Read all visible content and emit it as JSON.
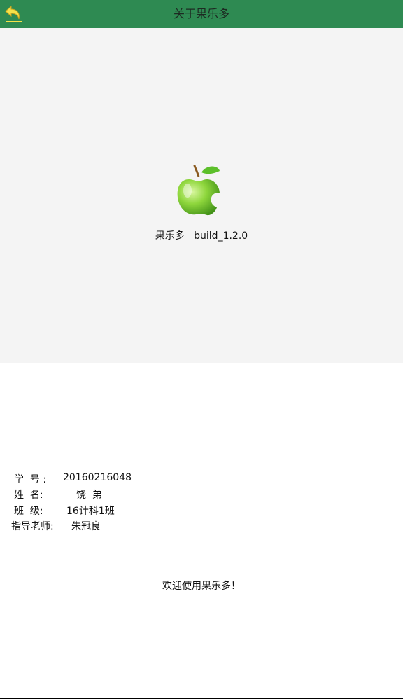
{
  "toolbar": {
    "title": "关于果乐多",
    "back_icon": "back-arrow-icon",
    "color": "#2e8a52"
  },
  "about": {
    "logo_icon": "green-apple-icon",
    "version_line": "果乐多   build_1.2.0",
    "background": "#f4f4f4"
  },
  "info": [
    {
      "label": "学  号 :",
      "value": "20160216048"
    },
    {
      "label": "姓  名:",
      "value": "饶  弟"
    },
    {
      "label": "班  级:",
      "value": "16计科1班"
    },
    {
      "label": "指导老师:",
      "value": "朱冠良"
    }
  ],
  "welcome": "欢迎使用果乐多！"
}
